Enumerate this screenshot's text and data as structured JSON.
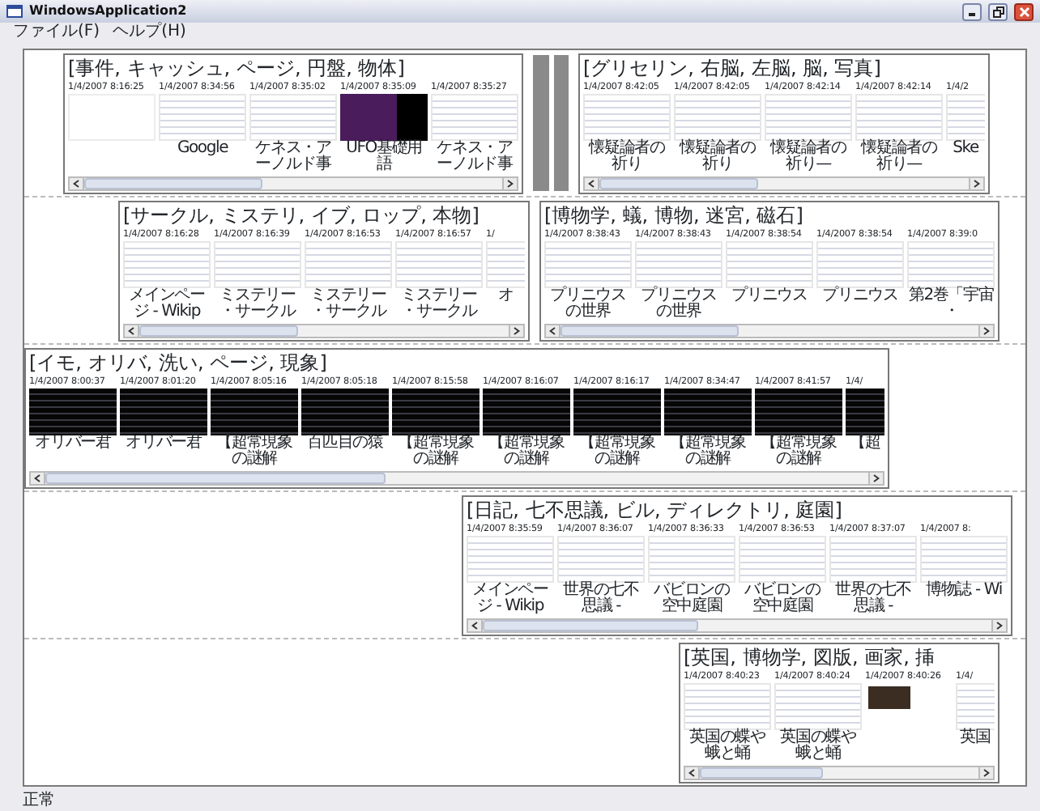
{
  "window": {
    "title": "WindowsApplication2"
  },
  "menu": [
    {
      "label": "ファイル(F)"
    },
    {
      "label": "ヘルプ(H)"
    }
  ],
  "rows": [
    {
      "panels": [
        {
          "kind": "group",
          "title": "[事件, キャッシュ, ページ, 円盤, 物体]",
          "pages": [
            {
              "time": "1/4/2007 8:16:25",
              "kind": "blank"
            },
            {
              "time": "1/4/2007 8:34:56",
              "kind": "light",
              "caption": "Google"
            },
            {
              "time": "1/4/2007 8:35:02",
              "kind": "light",
              "caption": "ケネス・アーノルド事"
            },
            {
              "time": "1/4/2007 8:35:09",
              "kind": "violet",
              "caption": "UFO基礎用語"
            },
            {
              "time": "1/4/2007 8:35:27",
              "kind": "light",
              "caption": "ケネス・アーノルド事"
            }
          ]
        },
        {
          "kind": "splitter"
        },
        {
          "kind": "group",
          "title": "[グリセリン, 右脳, 左脳, 脳, 写真]",
          "pages": [
            {
              "time": "1/4/2007 8:42:05",
              "kind": "light",
              "caption": "懐疑論者の祈り"
            },
            {
              "time": "1/4/2007 8:42:05",
              "kind": "light",
              "caption": "懐疑論者の祈り"
            },
            {
              "time": "1/4/2007 8:42:14",
              "kind": "light",
              "caption": "懐疑論者の祈り—"
            },
            {
              "time": "1/4/2007 8:42:14",
              "kind": "light",
              "caption": "懐疑論者の祈り—"
            },
            {
              "time": "1/4/2",
              "kind": "light",
              "caption": "Ske",
              "partial": true
            }
          ]
        }
      ]
    },
    {
      "panels": [
        {
          "kind": "group",
          "title": "[サークル, ミステリ, イブ, ロップ, 本物]",
          "pages": [
            {
              "time": "1/4/2007 8:16:28",
              "kind": "light",
              "caption": "メインページ - Wikip"
            },
            {
              "time": "1/4/2007 8:16:39",
              "kind": "light",
              "caption": "ミステリー・サークル"
            },
            {
              "time": "1/4/2007 8:16:53",
              "kind": "light",
              "caption": "ミステリー・サークル"
            },
            {
              "time": "1/4/2007 8:16:57",
              "kind": "light",
              "caption": "ミステリー・サークル"
            },
            {
              "time": "1/",
              "kind": "light",
              "caption": "オ",
              "partial": true
            }
          ]
        },
        {
          "kind": "group",
          "title": "[博物学, 蟻, 博物, 迷宮, 磁石]",
          "pages": [
            {
              "time": "1/4/2007 8:38:43",
              "kind": "light",
              "caption": "プリニウスの世界"
            },
            {
              "time": "1/4/2007 8:38:43",
              "kind": "light",
              "caption": "プリニウスの世界"
            },
            {
              "time": "1/4/2007 8:38:54",
              "kind": "light",
              "caption": "プリニウス"
            },
            {
              "time": "1/4/2007 8:38:54",
              "kind": "light",
              "caption": "プリニウス"
            },
            {
              "time": "1/4/2007 8:39:0",
              "kind": "light",
              "caption": "第2巻「宇宙・"
            }
          ]
        }
      ]
    },
    {
      "panels": [
        {
          "kind": "group",
          "title": "[イモ, オリバ, 洗い, ページ, 現象]",
          "pages": [
            {
              "time": "1/4/2007 8:00:37",
              "kind": "dark",
              "caption": "オリバー君"
            },
            {
              "time": "1/4/2007 8:01:20",
              "kind": "dark",
              "caption": "オリバー君"
            },
            {
              "time": "1/4/2007 8:05:16",
              "kind": "dark",
              "caption": "【超常現象の謎解"
            },
            {
              "time": "1/4/2007 8:05:18",
              "kind": "dark",
              "caption": "百匹目の猿"
            },
            {
              "time": "1/4/2007 8:15:58",
              "kind": "dark",
              "caption": "【超常現象の謎解"
            },
            {
              "time": "1/4/2007 8:16:07",
              "kind": "dark",
              "caption": "【超常現象の謎解"
            },
            {
              "time": "1/4/2007 8:16:17",
              "kind": "dark",
              "caption": "【超常現象の謎解"
            },
            {
              "time": "1/4/2007 8:34:47",
              "kind": "dark",
              "caption": "【超常現象の謎解"
            },
            {
              "time": "1/4/2007 8:41:57",
              "kind": "dark",
              "caption": "【超常現象の謎解"
            },
            {
              "time": "1/4/",
              "kind": "dark",
              "caption": "【超",
              "partial": true
            }
          ]
        }
      ]
    },
    {
      "panels": [
        {
          "kind": "group",
          "title": "[日記, 七不思議, ビル, ディレクトリ, 庭園]",
          "pages": [
            {
              "time": "1/4/2007 8:35:59",
              "kind": "light",
              "caption": "メインページ - Wikip"
            },
            {
              "time": "1/4/2007 8:36:07",
              "kind": "light",
              "caption": "世界の七不思議 -"
            },
            {
              "time": "1/4/2007 8:36:33",
              "kind": "light",
              "caption": "バビロンの空中庭園"
            },
            {
              "time": "1/4/2007 8:36:53",
              "kind": "light",
              "caption": "バビロンの空中庭園"
            },
            {
              "time": "1/4/2007 8:37:07",
              "kind": "light",
              "caption": "世界の七不思議 -"
            },
            {
              "time": "1/4/2007 8:",
              "kind": "light",
              "caption": "博物誌 - Wi"
            }
          ]
        }
      ]
    },
    {
      "panels": [
        {
          "kind": "group",
          "title": "[英国, 博物学, 図版, 画家, 挿",
          "pages": [
            {
              "time": "1/4/2007 8:40:23",
              "kind": "light",
              "caption": "英国の蝶や蛾と蛹"
            },
            {
              "time": "1/4/2007 8:40:24",
              "kind": "light",
              "caption": "英国の蝶や蛾と蛹"
            },
            {
              "time": "1/4/2007 8:40:26",
              "kind": "photo"
            },
            {
              "time": "1/4/",
              "kind": "light",
              "caption": "英国",
              "partial": true
            }
          ]
        }
      ]
    }
  ],
  "status_bar": "正常"
}
